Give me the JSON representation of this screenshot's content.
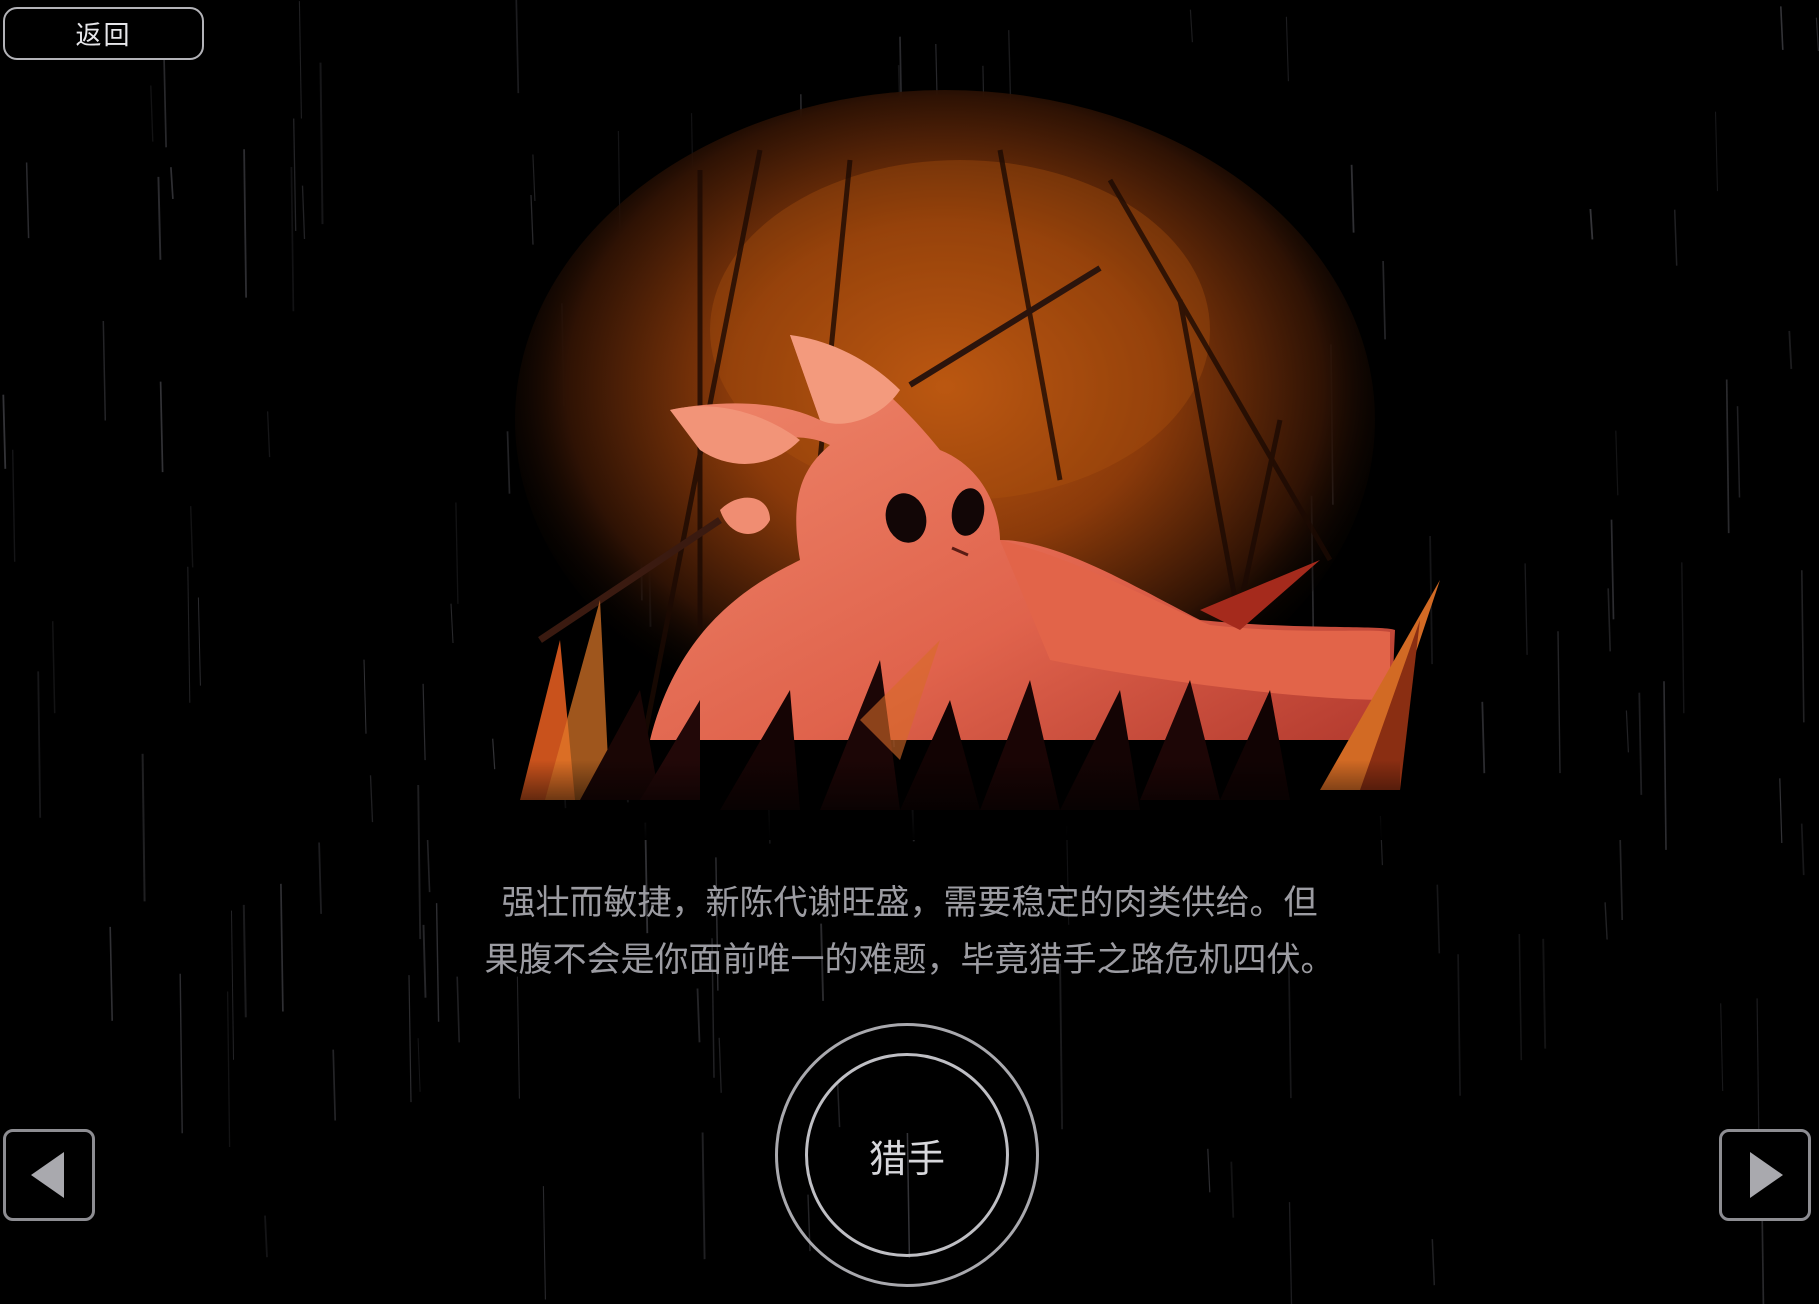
{
  "header": {
    "back_label": "返回"
  },
  "description": {
    "line1": "强壮而敏捷，新陈代谢旺盛，需要稳定的肉类供给。但",
    "line2": "果腹不会是你面前唯一的难题，毕竟猎手之路危机四伏。"
  },
  "selection": {
    "class_name": "猎手"
  },
  "navigation": {
    "prev_icon": "triangle-left-icon",
    "next_icon": "triangle-right-icon"
  },
  "colors": {
    "background": "#000000",
    "accent_orange": "#d9642e",
    "creature": "#e8705a",
    "ui_outline": "#b3b3b8",
    "text": "#9c9ca2"
  }
}
